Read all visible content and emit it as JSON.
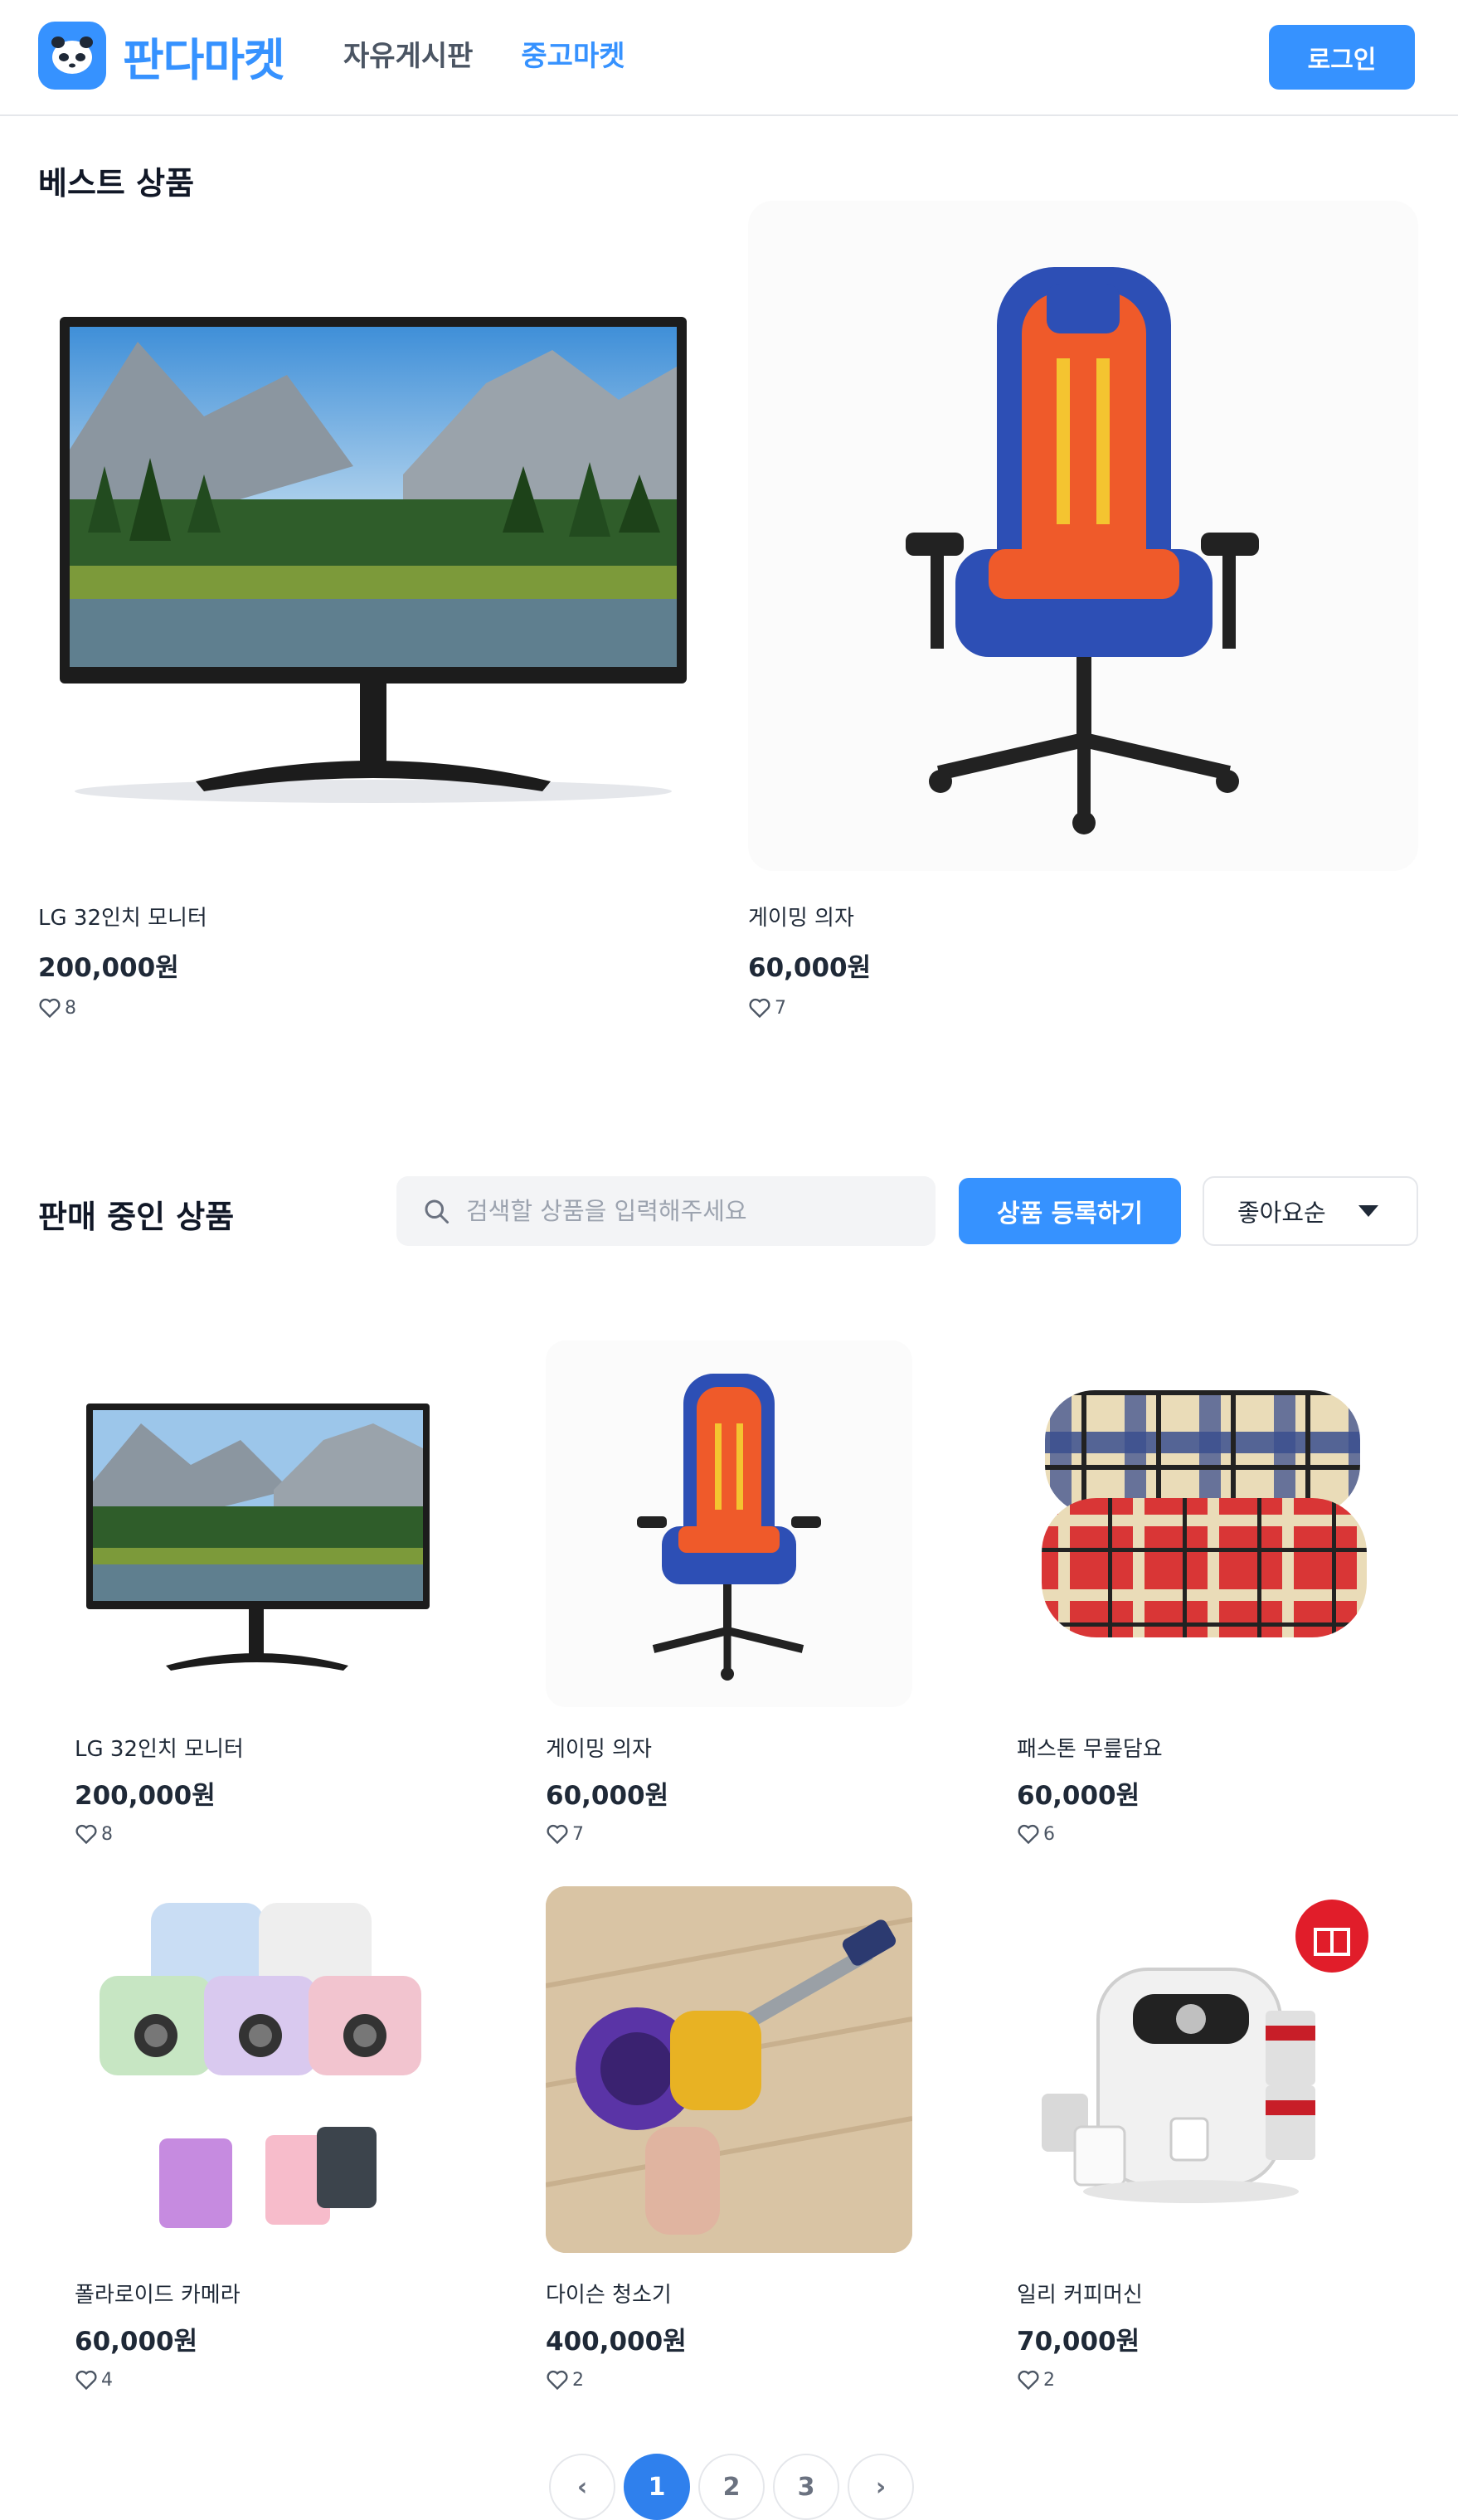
{
  "header": {
    "logo_text": "판다마켓",
    "nav": [
      {
        "label": "자유게시판",
        "active": false
      },
      {
        "label": "중고마켓",
        "active": true
      }
    ],
    "login_label": "로그인"
  },
  "best": {
    "title": "베스트 상품",
    "items": [
      {
        "name": "LG 32인치 모니터",
        "price": "200,000원",
        "likes": "8",
        "image": "monitor"
      },
      {
        "name": "게이밍 의자",
        "price": "60,000원",
        "likes": "7",
        "image": "gaming-chair"
      }
    ]
  },
  "sale": {
    "title": "판매 중인 상품",
    "search_placeholder": "검색할 상품을 입력해주세요",
    "register_label": "상품 등록하기",
    "sort_value": "좋아요순",
    "items": [
      {
        "name": "LG 32인치 모니터",
        "price": "200,000원",
        "likes": "8",
        "image": "monitor"
      },
      {
        "name": "게이밍 의자",
        "price": "60,000원",
        "likes": "7",
        "image": "gaming-chair"
      },
      {
        "name": "패스톤 무릎담요",
        "price": "60,000원",
        "likes": "6",
        "image": "blanket"
      },
      {
        "name": "폴라로이드 카메라",
        "price": "60,000원",
        "likes": "4",
        "image": "instant-cameras"
      },
      {
        "name": "다이슨 청소기",
        "price": "400,000원",
        "likes": "2",
        "image": "vacuum"
      },
      {
        "name": "일리 커피머신",
        "price": "70,000원",
        "likes": "2",
        "image": "coffee-machine"
      }
    ]
  },
  "pagination": {
    "prev": "‹",
    "pages": [
      "1",
      "2",
      "3"
    ],
    "current": "1",
    "next": "›"
  },
  "colors": {
    "brand": "#3692ff",
    "active_page": "#2f80ed"
  },
  "icons": [
    "panda-logo-icon",
    "search-icon",
    "chevron-down-icon",
    "heart-icon",
    "chevron-left-icon",
    "chevron-right-icon"
  ]
}
